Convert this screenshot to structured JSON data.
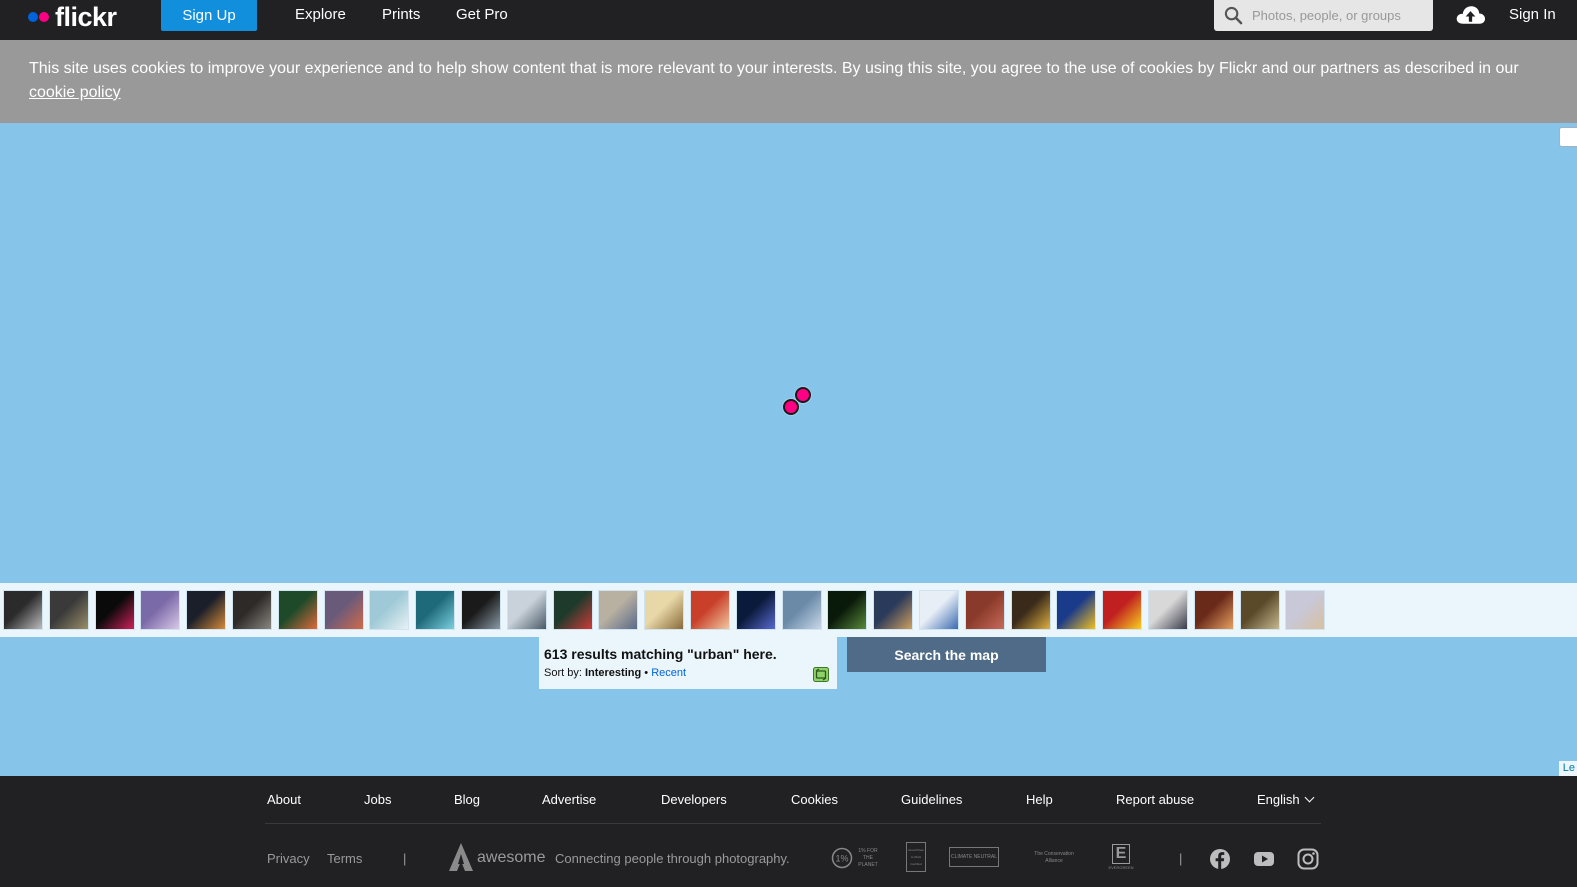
{
  "header": {
    "logo_text": "flickr",
    "signup_label": "Sign Up",
    "nav": [
      "Explore",
      "Prints",
      "Get Pro"
    ],
    "search_placeholder": "Photos, people, or groups",
    "signin_label": "Sign In",
    "icons": {
      "search": "search-icon",
      "upload": "cloud-upload-icon"
    }
  },
  "cookie_banner": {
    "text": "This site uses cookies to improve your experience and to help show content that is more relevant to your interests. By using this site, you agree to the use of cookies by Flickr and our partners as described in our ",
    "link_text": "cookie policy"
  },
  "map": {
    "attribution": "Le",
    "pins": 2
  },
  "thumbnails": [
    {
      "colors": [
        "#2b2b2b",
        "#bdbdbd"
      ]
    },
    {
      "colors": [
        "#3a3a3a",
        "#9a8f6a"
      ]
    },
    {
      "colors": [
        "#0a0a0a",
        "#d0205a"
      ]
    },
    {
      "colors": [
        "#7b6aa8",
        "#d9c8e8"
      ]
    },
    {
      "colors": [
        "#1b1f2a",
        "#d58b3a"
      ]
    },
    {
      "colors": [
        "#2e2a28",
        "#8a8680"
      ]
    },
    {
      "colors": [
        "#1e4a2a",
        "#e06a3a"
      ]
    },
    {
      "colors": [
        "#6a5a7a",
        "#d06a4a"
      ]
    },
    {
      "colors": [
        "#9fc9d6",
        "#e8f2f4"
      ]
    },
    {
      "colors": [
        "#1f6a7a",
        "#7ad0e0"
      ]
    },
    {
      "colors": [
        "#1a1a1a",
        "#8a9aa6"
      ]
    },
    {
      "colors": [
        "#c9d2da",
        "#4a5a66"
      ]
    },
    {
      "colors": [
        "#1e3a2a",
        "#d03a3a"
      ]
    },
    {
      "colors": [
        "#b8b0a0",
        "#5a6a8a"
      ]
    },
    {
      "colors": [
        "#e8d8a8",
        "#8a6a3a"
      ]
    },
    {
      "colors": [
        "#c8402a",
        "#f0c8a0"
      ]
    },
    {
      "colors": [
        "#0a1a3a",
        "#5a6ad0"
      ]
    },
    {
      "colors": [
        "#6a8aa8",
        "#c8d8e8"
      ]
    },
    {
      "colors": [
        "#0a1a0a",
        "#5a8a3a"
      ]
    },
    {
      "colors": [
        "#2a3a5a",
        "#d0a060"
      ]
    },
    {
      "colors": [
        "#e8eef6",
        "#3a6ab0"
      ]
    },
    {
      "colors": [
        "#8a3a2a",
        "#c86a5a"
      ]
    },
    {
      "colors": [
        "#3a2a1a",
        "#e0b040"
      ]
    },
    {
      "colors": [
        "#1a3a8a",
        "#f0c020"
      ]
    },
    {
      "colors": [
        "#c02020",
        "#f8d020"
      ]
    },
    {
      "colors": [
        "#d8d8d8",
        "#3a3a4a"
      ]
    },
    {
      "colors": [
        "#6a2a1a",
        "#e8a060"
      ]
    },
    {
      "colors": [
        "#5a4a2a",
        "#c8b890"
      ]
    },
    {
      "colors": [
        "#c8c8d8",
        "#d8c0a0"
      ]
    }
  ],
  "results": {
    "count_text": "613 results matching \"urban\" here.",
    "sort_prefix": "Sort by:",
    "sort_active": "Interesting",
    "sort_separator": "•",
    "sort_other": "Recent"
  },
  "search_map_label": "Search the map",
  "footer": {
    "links": [
      "About",
      "Jobs",
      "Blog",
      "Advertise",
      "Developers",
      "Cookies",
      "Guidelines",
      "Help",
      "Report abuse",
      "English"
    ],
    "small_links": [
      "Privacy",
      "Terms"
    ],
    "separator": "|",
    "brand_word": "awesome",
    "tagline": "Connecting people through photography.",
    "badges": [
      "1% FOR THE PLANET",
      "Great Place to Work Certified",
      "CLIMATE NEUTRAL",
      "The Conservation Alliance",
      "EVERGREEN"
    ],
    "social": [
      "facebook-icon",
      "youtube-icon",
      "instagram-icon"
    ]
  }
}
